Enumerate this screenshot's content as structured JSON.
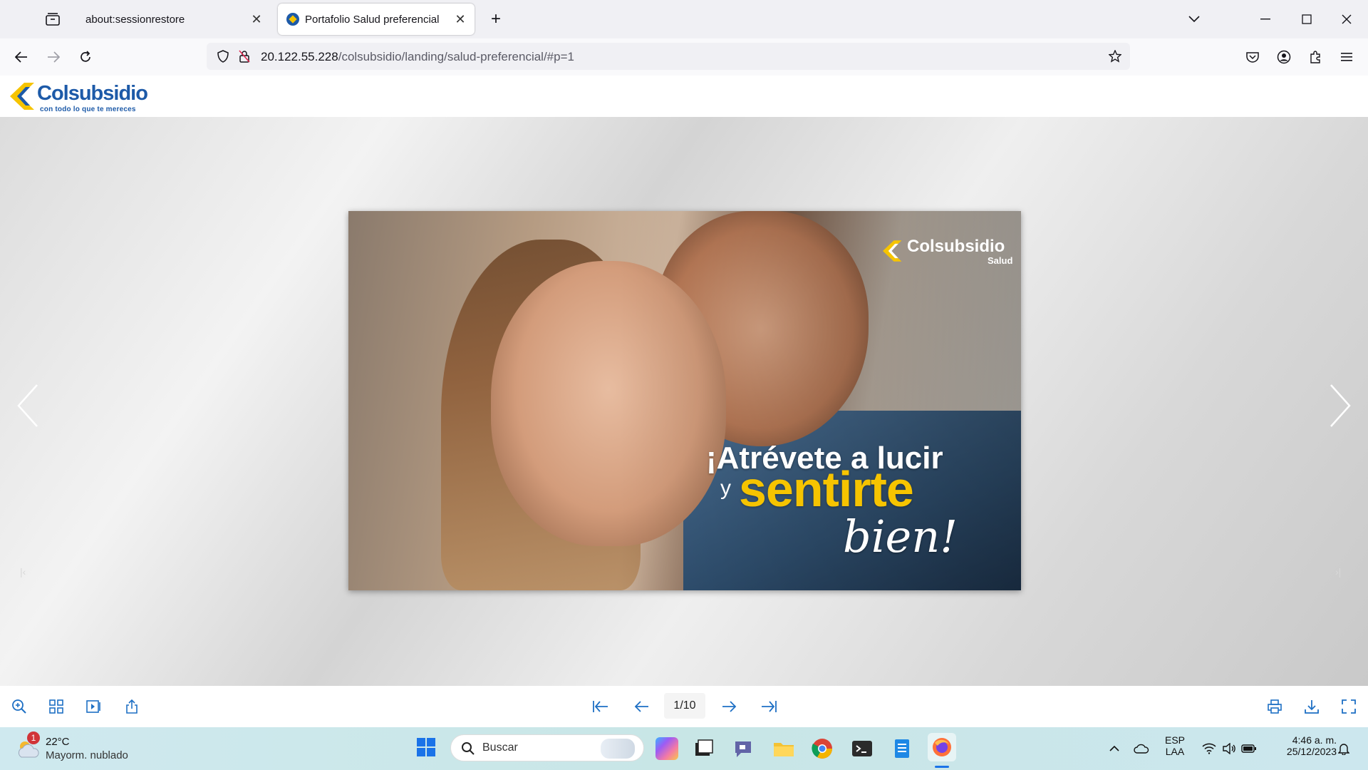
{
  "browser": {
    "tabs": [
      {
        "label": "about:sessionrestore"
      },
      {
        "label": "Portafolio Salud preferencial"
      }
    ],
    "url": {
      "host": "20.122.55.228",
      "path": "/colsubsidio/landing/salud-preferencial/#p=1"
    }
  },
  "site": {
    "logo_name": "Colsubsidio",
    "logo_tagline": "con todo lo que te mereces"
  },
  "flipbook": {
    "brand_name": "Colsubsidio",
    "brand_sub": "Salud",
    "headline_line1": "¡Atrévete a lucir",
    "headline_y": "y",
    "headline_line2": "sentirte",
    "headline_line3": "bien!",
    "page_indicator": "1/10",
    "current_page": 1,
    "total_pages": 10
  },
  "taskbar": {
    "weather_badge": "1",
    "weather_temp": "22°C",
    "weather_desc": "Mayorm. nublado",
    "search_label": "Buscar",
    "lang_line1": "ESP",
    "lang_line2": "LAA",
    "time": "4:46 a. m.",
    "date": "25/12/2023"
  },
  "colors": {
    "brand_blue": "#1d5aa8",
    "brand_yellow": "#f6c400"
  }
}
